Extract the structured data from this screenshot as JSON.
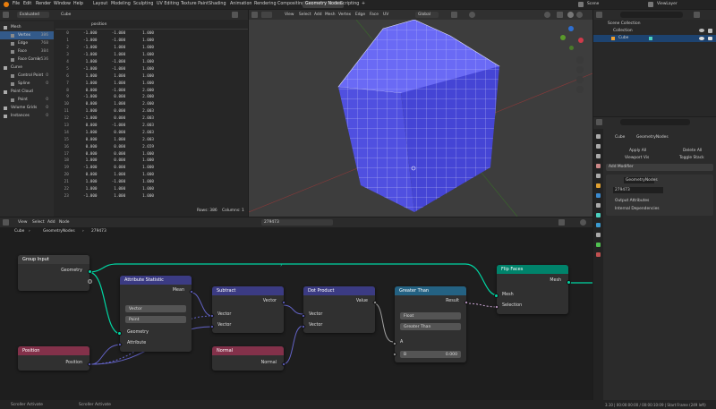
{
  "menu": [
    "File",
    "Edit",
    "Render",
    "Window",
    "Help"
  ],
  "workspaces": [
    "Layout",
    "Modeling",
    "Sculpting",
    "UV Editing",
    "Texture Paint",
    "Shading",
    "Animation",
    "Rendering",
    "Compositing",
    "Geometry Nodes",
    "Scripting"
  ],
  "active_workspace": "Geometry Nodes",
  "scene": "Scene",
  "view_layer": "ViewLayer",
  "spreadsheet": {
    "mode": "Evaluated",
    "object": "Cube",
    "sidebar": [
      {
        "label": "Mesh",
        "count": "",
        "indent": 0,
        "sel": false
      },
      {
        "label": "Vertex",
        "count": "386",
        "indent": 1,
        "sel": true
      },
      {
        "label": "Edge",
        "count": "768",
        "indent": 1,
        "sel": false
      },
      {
        "label": "Face",
        "count": "384",
        "indent": 1,
        "sel": false
      },
      {
        "label": "Face Corner",
        "count": "1,536",
        "indent": 1,
        "sel": false
      },
      {
        "label": "Curve",
        "count": "",
        "indent": 0,
        "sel": false
      },
      {
        "label": "Control Point",
        "count": "0",
        "indent": 1,
        "sel": false
      },
      {
        "label": "Spline",
        "count": "0",
        "indent": 1,
        "sel": false
      },
      {
        "label": "Point Cloud",
        "count": "",
        "indent": 0,
        "sel": false
      },
      {
        "label": "Point",
        "count": "0",
        "indent": 1,
        "sel": false
      },
      {
        "label": "Volume Grids",
        "count": "0",
        "indent": 0,
        "sel": false
      },
      {
        "label": "Instances",
        "count": "0",
        "indent": 0,
        "sel": false
      }
    ],
    "column_header": "position",
    "rows": [
      [
        "0",
        "-1.000",
        "-1.000",
        "1.000"
      ],
      [
        "1",
        "-1.000",
        "-1.000",
        "1.000"
      ],
      [
        "2",
        "-1.000",
        "1.000",
        "1.000"
      ],
      [
        "3",
        "-1.000",
        "1.000",
        "1.000"
      ],
      [
        "4",
        "1.000",
        "-1.000",
        "1.000"
      ],
      [
        "5",
        "-1.000",
        "-1.000",
        "1.000"
      ],
      [
        "6",
        "1.000",
        "1.000",
        "1.000"
      ],
      [
        "7",
        "1.000",
        "1.000",
        "1.000"
      ],
      [
        "8",
        "0.000",
        "-1.000",
        "2.000"
      ],
      [
        "9",
        "-1.000",
        "0.000",
        "2.000"
      ],
      [
        "10",
        "0.000",
        "1.000",
        "2.000"
      ],
      [
        "11",
        "1.000",
        "0.000",
        "2.003"
      ],
      [
        "12",
        "-1.000",
        "0.000",
        "2.003"
      ],
      [
        "13",
        "0.000",
        "-1.000",
        "2.003"
      ],
      [
        "14",
        "1.000",
        "0.000",
        "2.003"
      ],
      [
        "15",
        "0.000",
        "1.000",
        "2.003"
      ],
      [
        "16",
        "0.000",
        "0.000",
        "2.659"
      ],
      [
        "17",
        "0.000",
        "0.000",
        "1.000"
      ],
      [
        "18",
        "1.000",
        "0.000",
        "1.000"
      ],
      [
        "19",
        "-1.000",
        "0.000",
        "1.000"
      ],
      [
        "20",
        "0.000",
        "1.000",
        "1.000"
      ],
      [
        "21",
        "1.000",
        "-1.000",
        "1.000"
      ],
      [
        "22",
        "1.000",
        "1.000",
        "1.000"
      ],
      [
        "23",
        "-1.000",
        "1.000",
        "1.000"
      ]
    ],
    "footer_rows": "Rows: 386",
    "footer_cols": "Columns: 1"
  },
  "viewport": {
    "menu": [
      "View",
      "Select",
      "Add",
      "Mesh",
      "Vertex",
      "Edge",
      "Face",
      "UV"
    ],
    "transform": "Global"
  },
  "outliner": {
    "title": "Scene Collection",
    "collection": "Collection",
    "object": "Cube"
  },
  "properties": {
    "breadcrumb_obj": "Cube",
    "breadcrumb_mod": "GeometryNodes",
    "apply_all": "Apply All",
    "delete_all": "Delete All",
    "viewport_vis": "Viewport Vis",
    "toggle_stack": "Toggle Stack",
    "add_modifier": "Add Modifier",
    "modifier_name": "GeometryNodes",
    "node_group": "279473",
    "output_attrs": "Output Attributes",
    "internal_deps": "Internal Dependencies"
  },
  "node_editor": {
    "menu": [
      "View",
      "Select",
      "Add",
      "Node"
    ],
    "node_group": "279473",
    "breadcrumb": [
      "Cube",
      "GeometryNodes",
      "279473"
    ]
  },
  "nodes": {
    "group_input": {
      "title": "Group Input",
      "out": "Geometry"
    },
    "attr_stat": {
      "title": "Attribute Statistic",
      "out": "Mean",
      "dd1": "Vector",
      "dd2": "Point",
      "in1": "Geometry",
      "in2": "Attribute"
    },
    "subtract": {
      "title": "Subtract",
      "out": "Vector",
      "in1": "Vector",
      "in2": "Vector"
    },
    "dot": {
      "title": "Dot Product",
      "out": "Value",
      "in1": "Vector",
      "in2": "Vector"
    },
    "greater": {
      "title": "Greater Than",
      "out": "Result",
      "dd1": "Float",
      "dd2": "Greater Than",
      "in1": "A",
      "in2": "B",
      "b_value": "0.000"
    },
    "flip": {
      "title": "Flip Faces",
      "out": "Mesh",
      "in1": "Mesh",
      "in2": "Selection"
    },
    "position": {
      "title": "Position",
      "out": "Position"
    },
    "normal": {
      "title": "Normal",
      "out": "Normal"
    }
  },
  "status": {
    "left1": "Scroller Activate",
    "left2": "Scroller Activate",
    "right": "3.10 | 00:00:00:00 / 00:00:10:09 | Start Frame (249 left)"
  },
  "colors": {
    "geo_socket": "#00d6a3",
    "vec_socket": "#6363c7",
    "input_header": "#83314a",
    "vector_header": "#3b3b83",
    "converter_header": "#246283",
    "geometry_header": "#00836b",
    "function_header": "#83314a",
    "cube_face": "#5050e0"
  }
}
